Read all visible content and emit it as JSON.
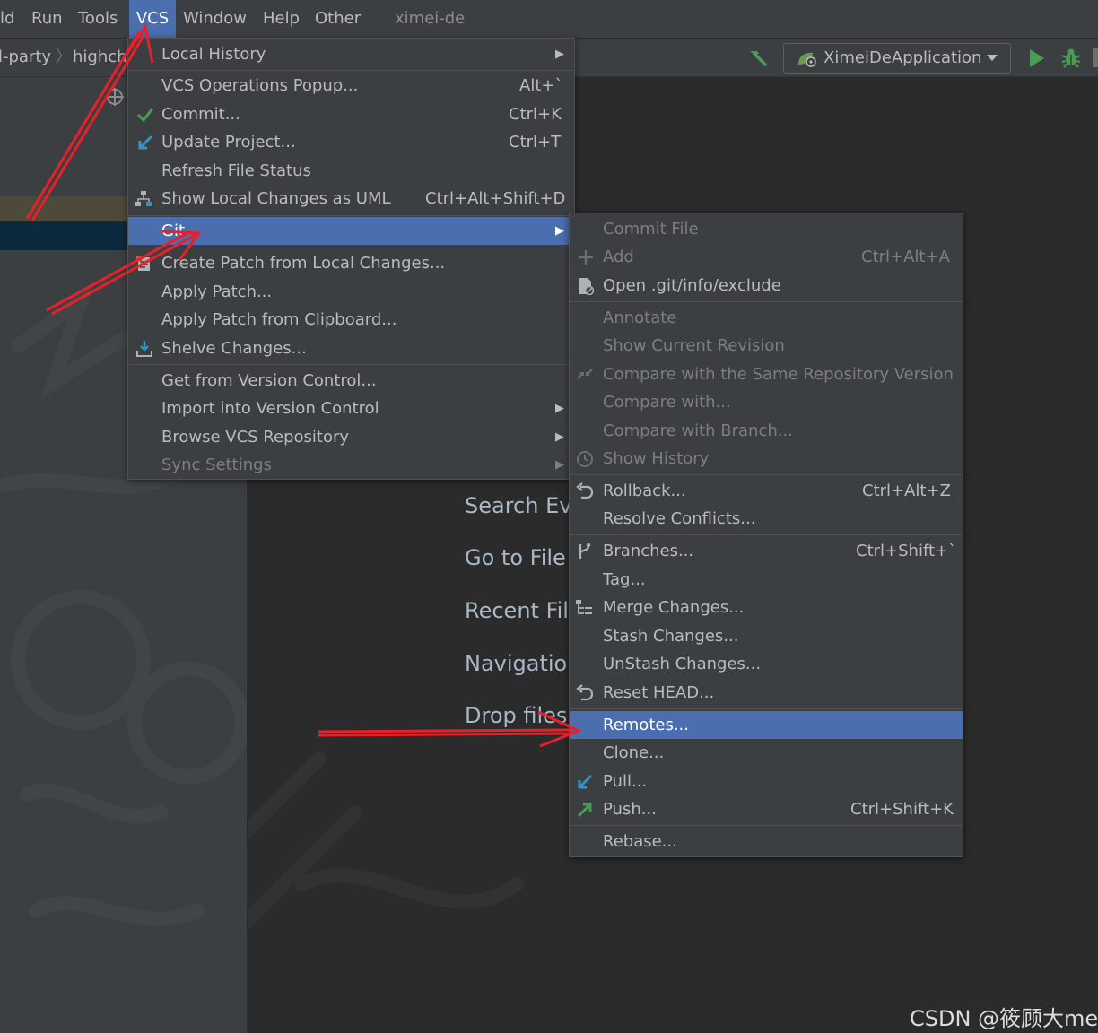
{
  "menubar": {
    "items": [
      "ld",
      "Run",
      "Tools",
      "VCS",
      "Window",
      "Help",
      "Other"
    ],
    "project": "ximei-de"
  },
  "navbar": {
    "crumbs": [
      "l-party",
      "highch"
    ],
    "run_config": "XimeiDeApplication"
  },
  "editor_hints": [
    "Search Eve",
    "Go to File",
    "Recent File",
    "Navigation",
    "Drop files"
  ],
  "vcs_menu": [
    {
      "label": "Local History",
      "submenu": true
    },
    {
      "label": "VCS Operations Popup...",
      "shortcut": "Alt+`"
    },
    {
      "label": "Commit...",
      "shortcut": "Ctrl+K",
      "icon": "check-icon"
    },
    {
      "label": "Update Project...",
      "shortcut": "Ctrl+T",
      "icon": "update-arrow-icon"
    },
    {
      "label": "Refresh File Status"
    },
    {
      "label": "Show Local Changes as UML",
      "shortcut": "Ctrl+Alt+Shift+D",
      "icon": "uml-icon"
    },
    {
      "label": "Git",
      "submenu": true,
      "selected": true
    },
    {
      "label": "Create Patch from Local Changes...",
      "icon": "patch-icon"
    },
    {
      "label": "Apply Patch..."
    },
    {
      "label": "Apply Patch from Clipboard..."
    },
    {
      "label": "Shelve Changes...",
      "icon": "shelve-icon"
    },
    {
      "label": "Get from Version Control..."
    },
    {
      "label": "Import into Version Control",
      "submenu": true
    },
    {
      "label": "Browse VCS Repository",
      "submenu": true
    },
    {
      "label": "Sync Settings",
      "submenu": true,
      "disabled": true
    }
  ],
  "git_menu": [
    {
      "label": "Commit File",
      "disabled": true
    },
    {
      "label": "Add",
      "shortcut": "Ctrl+Alt+A",
      "disabled": true,
      "icon": "plus-icon"
    },
    {
      "label": "Open .git/info/exclude",
      "icon": "file-exclude-icon"
    },
    {
      "label": "Annotate",
      "disabled": true
    },
    {
      "label": "Show Current Revision",
      "disabled": true
    },
    {
      "label": "Compare with the Same Repository Version",
      "disabled": true,
      "icon": "compare-icon"
    },
    {
      "label": "Compare with...",
      "disabled": true
    },
    {
      "label": "Compare with Branch...",
      "disabled": true
    },
    {
      "label": "Show History",
      "disabled": true,
      "icon": "clock-icon"
    },
    {
      "label": "Rollback...",
      "shortcut": "Ctrl+Alt+Z",
      "icon": "rollback-icon"
    },
    {
      "label": "Resolve Conflicts..."
    },
    {
      "label": "Branches...",
      "shortcut": "Ctrl+Shift+`",
      "icon": "branch-icon"
    },
    {
      "label": "Tag..."
    },
    {
      "label": "Merge Changes...",
      "icon": "merge-icon"
    },
    {
      "label": "Stash Changes..."
    },
    {
      "label": "UnStash Changes..."
    },
    {
      "label": "Reset HEAD...",
      "icon": "reset-icon"
    },
    {
      "label": "Remotes...",
      "selected": true
    },
    {
      "label": "Clone..."
    },
    {
      "label": "Pull...",
      "icon": "pull-icon"
    },
    {
      "label": "Push...",
      "shortcut": "Ctrl+Shift+K",
      "icon": "push-icon"
    },
    {
      "label": "Rebase..."
    }
  ],
  "watermark": "CSDN @筱顾大men",
  "colors": {
    "selection": "#4b6eaf",
    "annotation_arrow": "#e8202a",
    "run_green": "#499c54"
  }
}
